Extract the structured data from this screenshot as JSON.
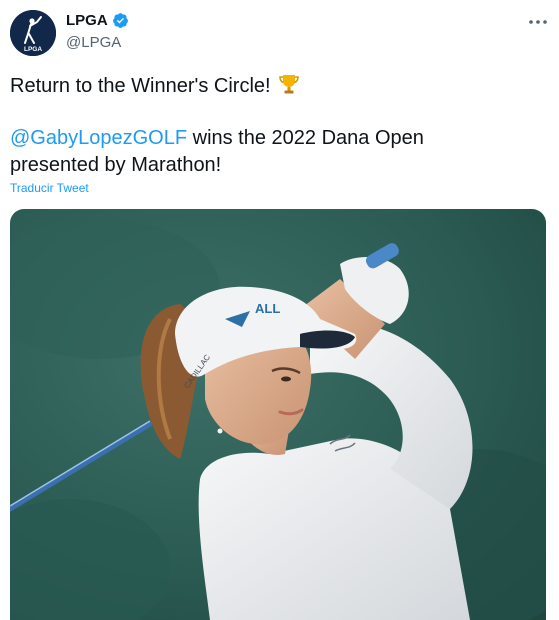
{
  "author": {
    "display_name": "LPGA",
    "handle": "@LPGA",
    "verified": true,
    "avatar_logo_text": "LPGA"
  },
  "tweet": {
    "line1": "Return to the Winner's Circle!",
    "line1_emoji": "trophy-icon",
    "mention": "@GabyLopezGOLF",
    "line2_rest": " wins the 2022 Dana Open",
    "line3": "presented by Marathon!",
    "translate_link": "Traducir Tweet"
  },
  "media": {
    "description_icon": "golfer-photo",
    "cap_brand_text": "CADILLAC",
    "cap_logo_text": "ALL"
  },
  "colors": {
    "link": "#1d9bf0",
    "text": "#0f1419",
    "secondary": "#536471",
    "avatar_bg": "#11284a",
    "photo_bg": "#2a5a52"
  }
}
